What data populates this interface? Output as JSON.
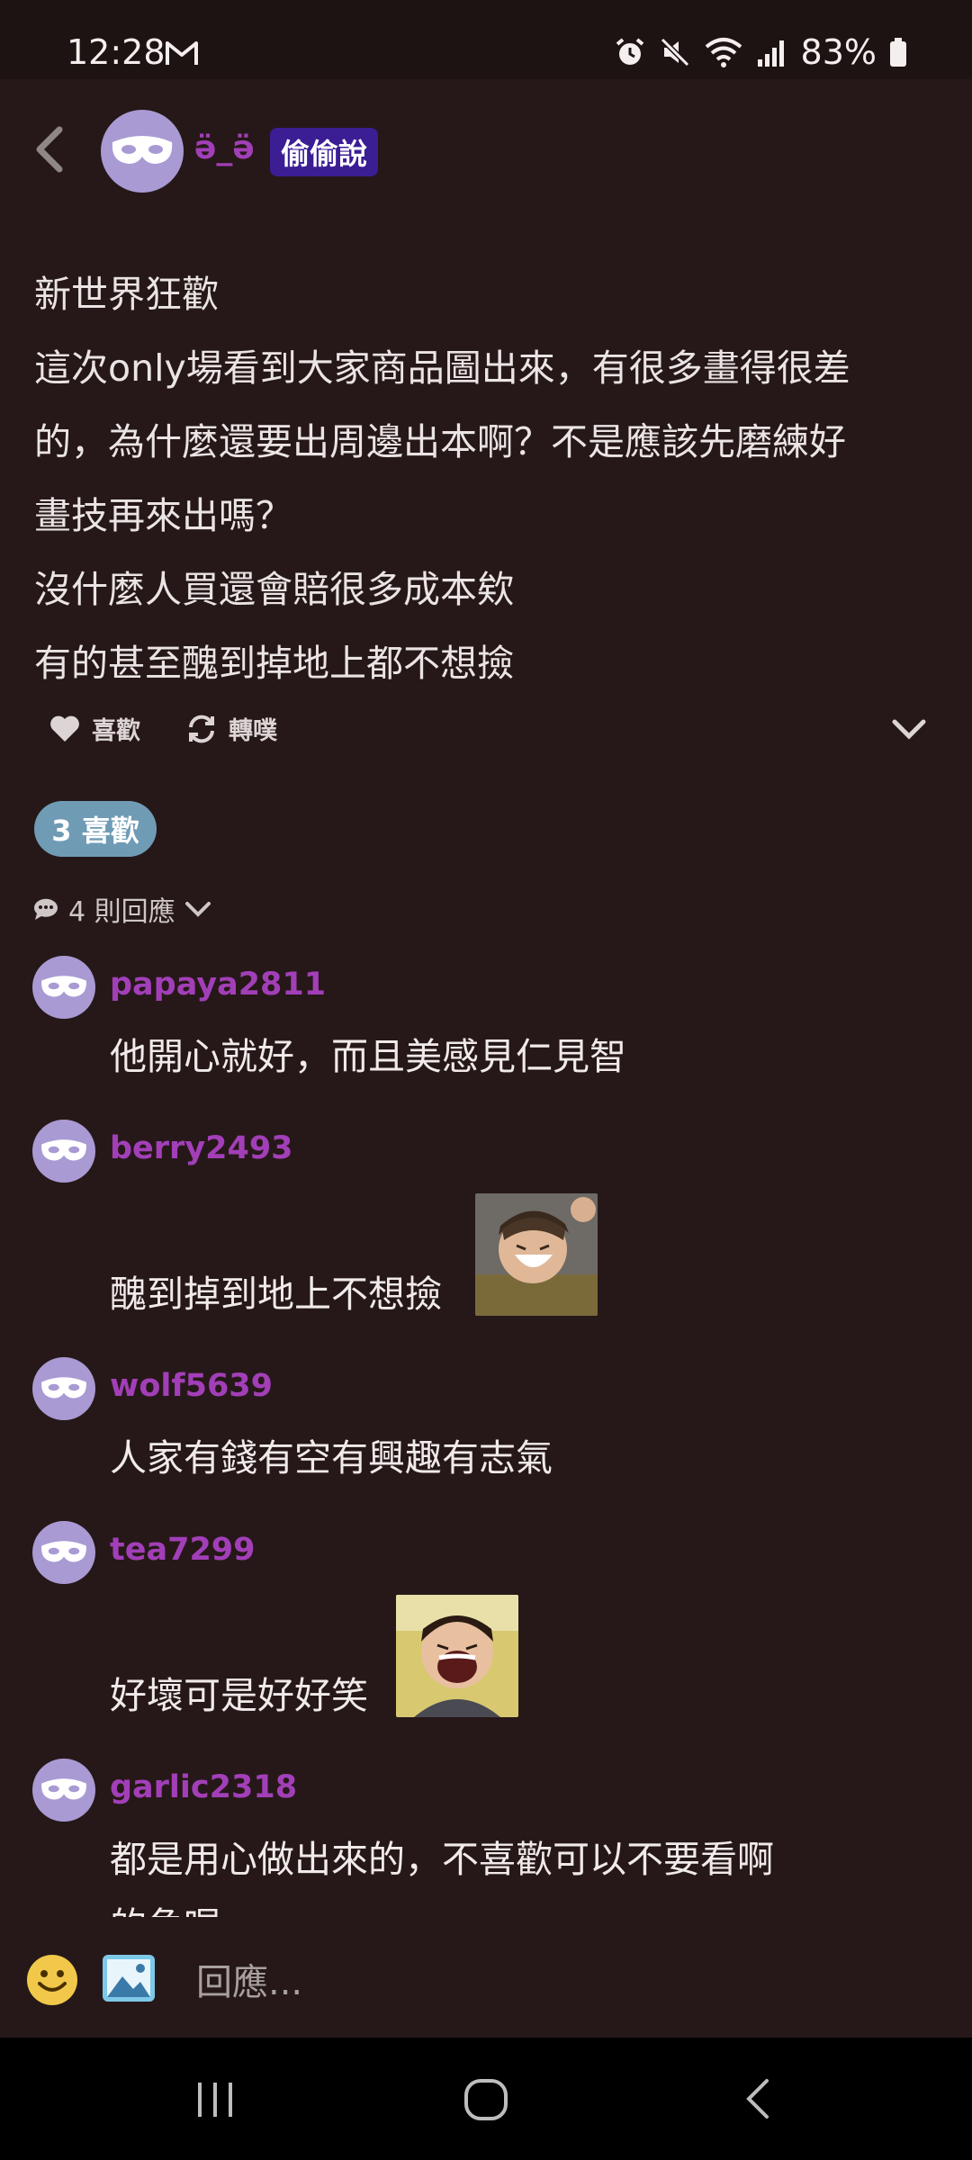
{
  "status_bar": {
    "time": "12:28",
    "battery": "83%"
  },
  "post": {
    "author": "ӛ_ӛ",
    "badge": "偷偷說",
    "lines": [
      "新世界狂歡",
      "這次only場看到大家商品圖出來，有很多畫得很差",
      "的，為什麼還要出周邊出本啊？不是應該先磨練好",
      "畫技再來出嗎？",
      "沒什麼人買還會賠很多成本欸",
      "有的甚至醜到掉地上都不想撿"
    ],
    "like_label": "喜歡",
    "repost_label": "轉噗",
    "likes_pill": "3 喜歡",
    "reply_count": "4 則回應"
  },
  "comments": [
    {
      "user": "papaya2811",
      "text": "他開心就好，而且美感見仁見智"
    },
    {
      "user": "berry2493",
      "text": "醜到掉到地上不想撿"
    },
    {
      "user": "wolf5639",
      "text": "人家有錢有空有興趣有志氣"
    },
    {
      "user": "tea7299",
      "text": "好壞可是好好笑"
    },
    {
      "user": "garlic2318",
      "text": "都是用心做出來的，不喜歡可以不要看啊",
      "cut_text": "的角喔"
    }
  ],
  "input": {
    "placeholder": "回應..."
  },
  "colors": {
    "background": "#261818",
    "username": "#a23fb8",
    "badge": "#3b1d94",
    "likes_pill": "#6f9bb5",
    "avatar": "#a99ad4"
  }
}
